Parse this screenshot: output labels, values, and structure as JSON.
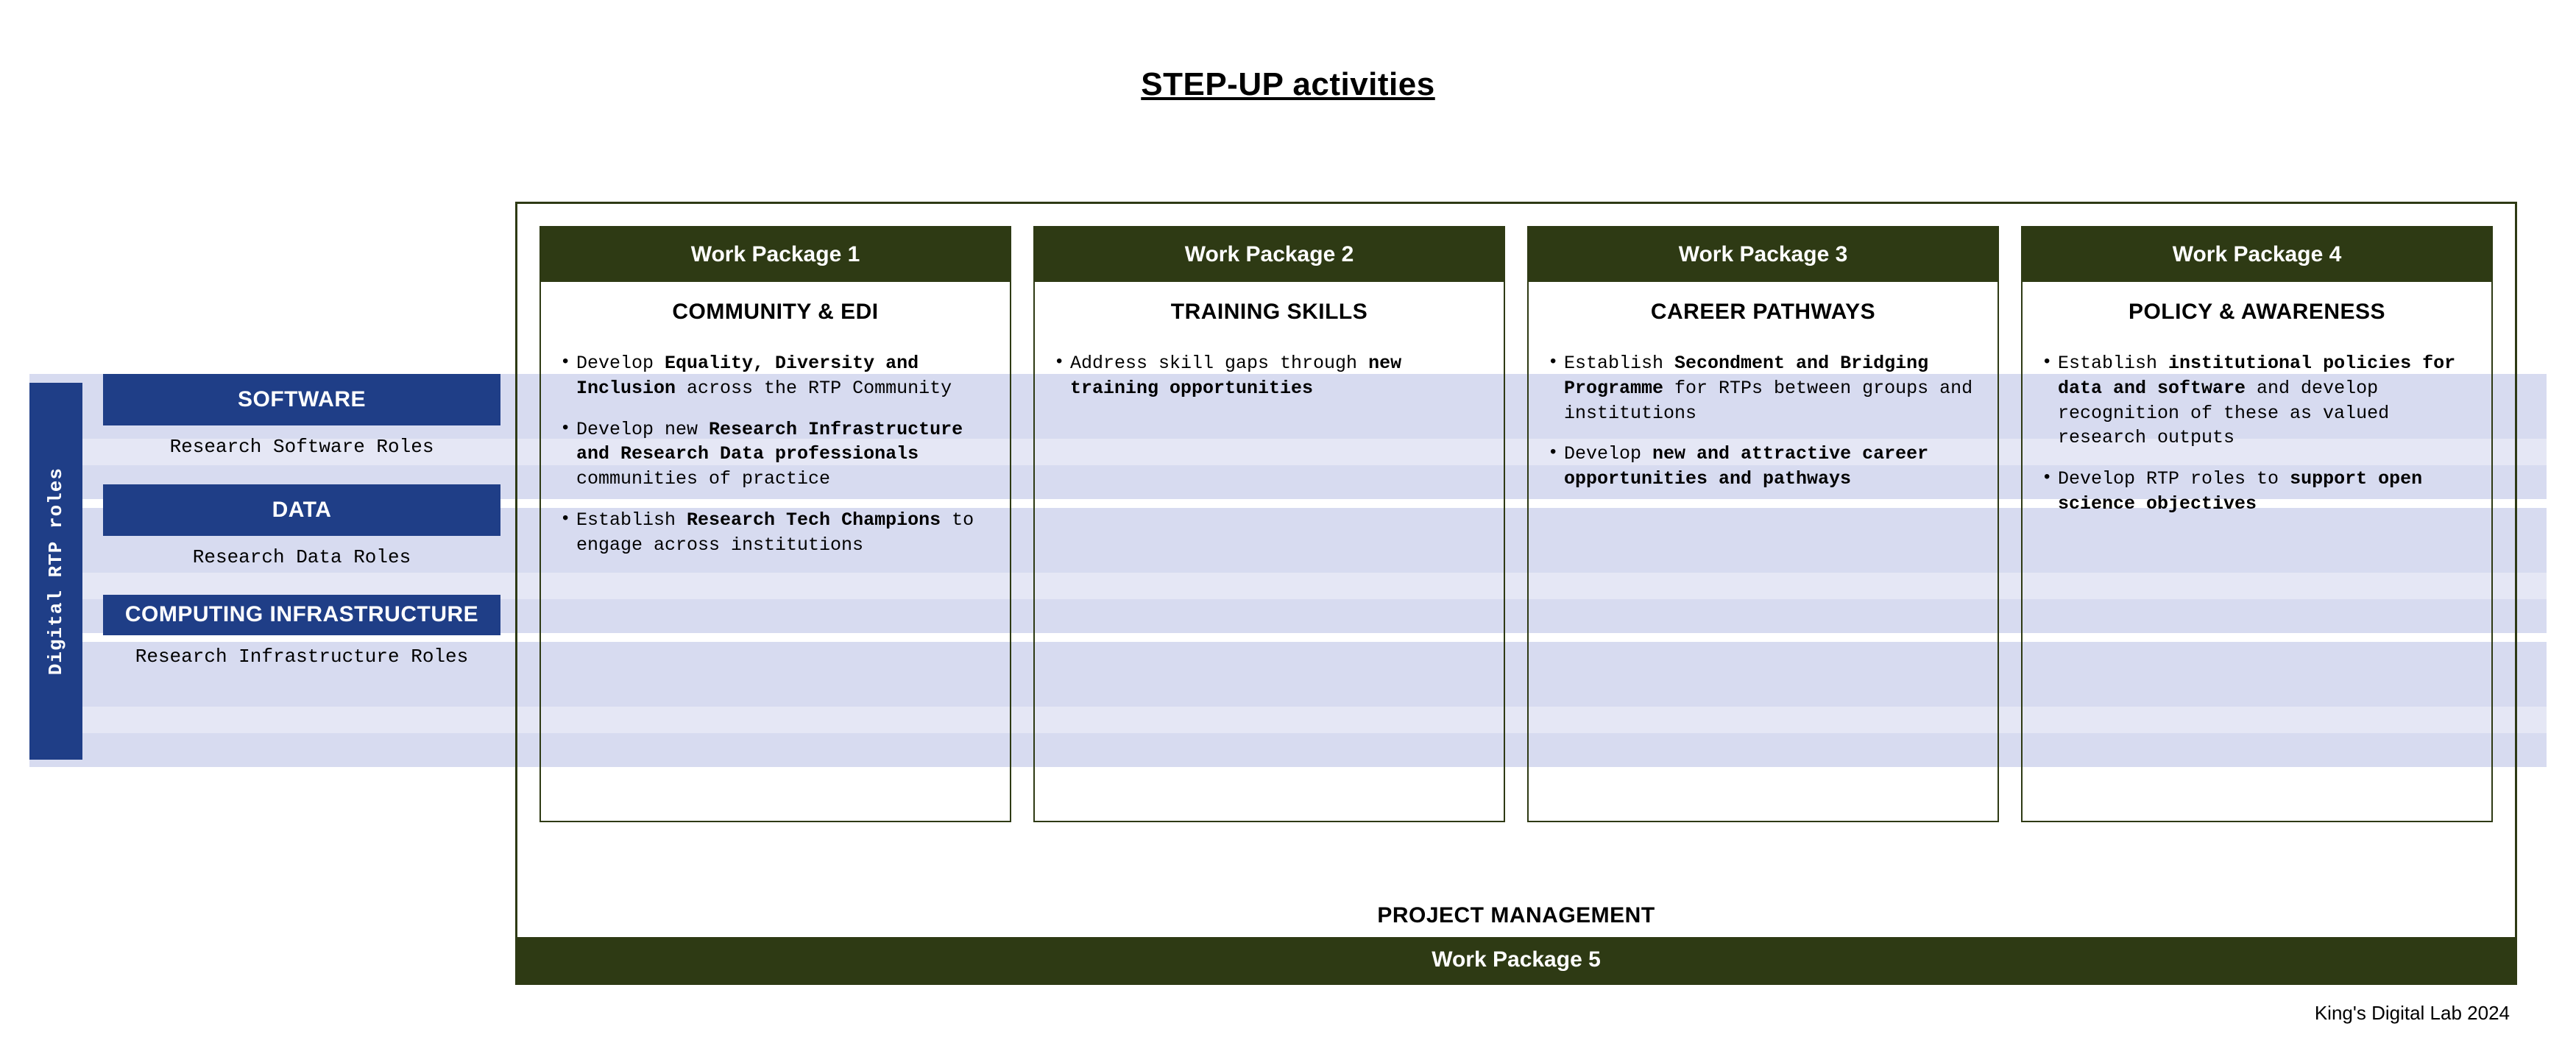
{
  "title": "STEP-UP activities",
  "sidebar": {
    "vertical_label": "Digital RTP roles",
    "roles": [
      {
        "name": "SOFTWARE",
        "desc": "Research Software Roles"
      },
      {
        "name": "DATA",
        "desc": "Research Data Roles"
      },
      {
        "name": "COMPUTING INFRASTRUCTURE",
        "desc": "Research Infrastructure Roles"
      }
    ]
  },
  "work_packages": [
    {
      "header": "Work Package 1",
      "subtitle": "COMMUNITY & EDI",
      "bullets": [
        {
          "pre": "Develop ",
          "bold": "Equality, Diversity and Inclusion",
          "post": " across the RTP Community"
        },
        {
          "pre": "Develop new ",
          "bold": "Research Infrastructure and Research Data professionals",
          "post": " communities of practice"
        },
        {
          "pre": "Establish ",
          "bold": "Research Tech Champions",
          "post": " to engage across institutions"
        }
      ]
    },
    {
      "header": "Work Package 2",
      "subtitle": "TRAINING SKILLS",
      "bullets": [
        {
          "pre": "Address skill gaps through ",
          "bold": "new training opportunities",
          "post": ""
        }
      ]
    },
    {
      "header": "Work Package 3",
      "subtitle": "CAREER PATHWAYS",
      "bullets": [
        {
          "pre": "Establish ",
          "bold": "Secondment and Bridging Programme",
          "post": " for RTPs between groups and institutions"
        },
        {
          "pre": "Develop ",
          "bold": "new and attractive career opportunities and pathways",
          "post": ""
        }
      ]
    },
    {
      "header": "Work Package 4",
      "subtitle": "POLICY & AWARENESS",
      "bullets": [
        {
          "pre": "Establish ",
          "bold": "institutional policies for data and software",
          "post": " and develop recognition of these as valued research outputs"
        },
        {
          "pre": "Develop RTP roles to ",
          "bold": "support open science objectives",
          "post": ""
        }
      ]
    }
  ],
  "project_management": {
    "label": "PROJECT MANAGEMENT",
    "bar": "Work Package 5"
  },
  "credit": "King's Digital Lab 2024"
}
